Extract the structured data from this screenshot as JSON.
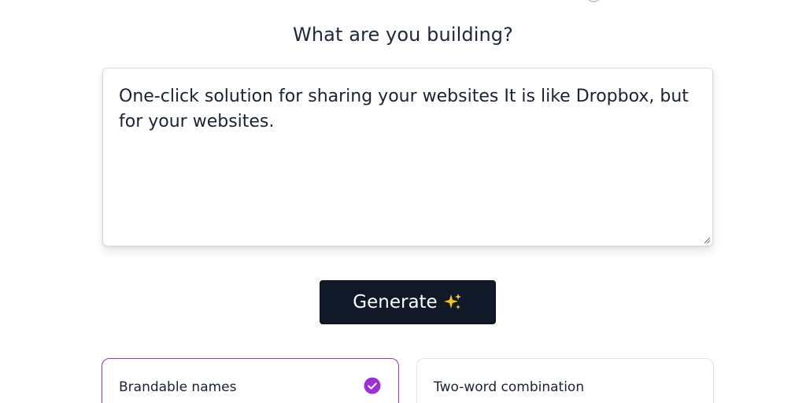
{
  "heading": "What are you building?",
  "prompt": {
    "value": "One-click solution for sharing your websites It is like Dropbox, but for your websites."
  },
  "generate_button": {
    "label": "Generate",
    "icon": "sparkles-icon"
  },
  "name_options": [
    {
      "label": "Brandable names",
      "selected": true
    },
    {
      "label": "Two-word combination",
      "selected": false
    }
  ],
  "colors": {
    "button_bg": "#111827",
    "accent_purple": "#9b30d9",
    "sparkle_yellow": "#f5c518",
    "text": "#1a2233"
  }
}
